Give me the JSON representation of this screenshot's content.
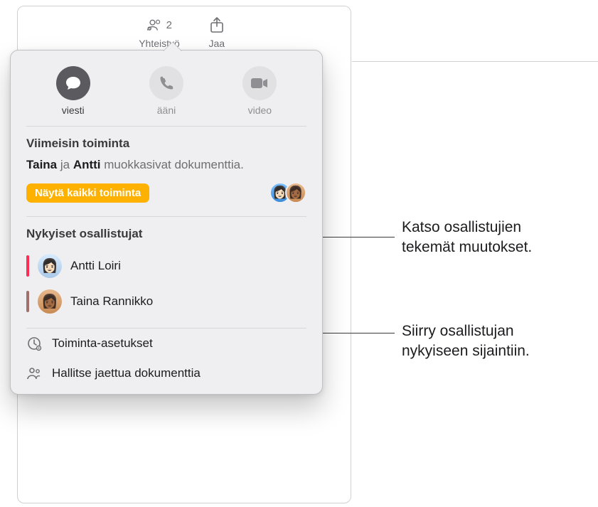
{
  "toolbar": {
    "collab_label": "Yhteistyö",
    "collab_count": "2",
    "share_label": "Jaa"
  },
  "popover": {
    "comm": {
      "message": "viesti",
      "audio": "ääni",
      "video": "video"
    },
    "activity": {
      "heading": "Viimeisin toiminta",
      "name1": "Taina",
      "joiner": " ja ",
      "name2": "Antti",
      "tail": " muokkasivat dokumenttia.",
      "show_all": "Näytä kaikki toiminta"
    },
    "participants": {
      "heading": "Nykyiset osallistujat",
      "list": [
        {
          "name": "Antti Loiri",
          "color": "pink",
          "avatar": "a1",
          "emoji": "👩🏻"
        },
        {
          "name": "Taina Rannikko",
          "color": "brown",
          "avatar": "a2",
          "emoji": "👩🏾"
        }
      ]
    },
    "settings": {
      "activity_settings": "Toiminta-asetukset",
      "manage_shared": "Hallitse jaettua dokumenttia"
    }
  },
  "callouts": {
    "c1_line1": "Katso osallistujien",
    "c1_line2": "tekemät muutokset.",
    "c2_line1": "Siirry osallistujan",
    "c2_line2": "nykyiseen sijaintiin."
  }
}
